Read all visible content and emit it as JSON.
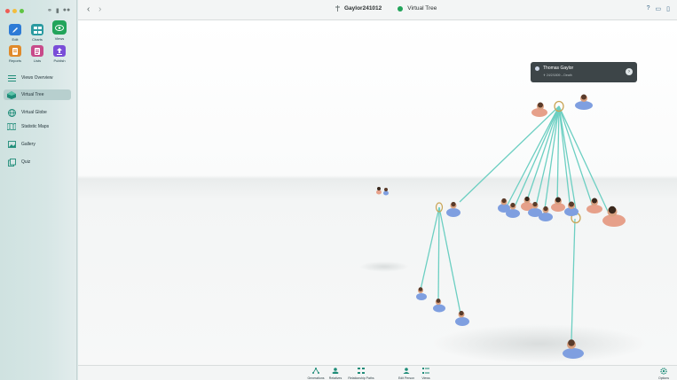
{
  "sidebar": {
    "tools": [
      {
        "label": "Edit",
        "icon": "pencil-icon",
        "color": "#2d7bd6"
      },
      {
        "label": "Charts",
        "icon": "charts-icon",
        "color": "#2a9aa0"
      },
      {
        "label": "Views",
        "icon": "eye-icon",
        "color": "#22a45a"
      },
      {
        "label": "Reports",
        "icon": "reports-icon",
        "color": "#e08a2a"
      },
      {
        "label": "Lists",
        "icon": "lists-icon",
        "color": "#c84a8a"
      },
      {
        "label": "Publish",
        "icon": "publish-icon",
        "color": "#7a4ed8"
      }
    ],
    "nav": [
      {
        "label": "Views Overview",
        "icon": "views-overview-icon"
      },
      {
        "label": "Virtual Tree",
        "icon": "virtual-tree-icon"
      },
      {
        "label": "Virtual Globe",
        "icon": "globe-icon"
      },
      {
        "label": "Statistic Maps",
        "icon": "map-icon"
      },
      {
        "label": "Gallery",
        "icon": "gallery-icon"
      },
      {
        "label": "Quiz",
        "icon": "quiz-icon"
      }
    ],
    "active_nav": "Virtual Tree"
  },
  "titlebar": {
    "file_name": "Gaylor241012",
    "view_name": "Virtual Tree"
  },
  "tooltip": {
    "name": "Thomas Gaylor",
    "detail": "24/2/1809 – Death"
  },
  "bottom_toolbar": [
    {
      "label": "Generations",
      "icon": "generations-icon"
    },
    {
      "label": "Relatives",
      "icon": "relatives-icon"
    },
    {
      "label": "Relationship Paths",
      "icon": "relationship-paths-icon"
    },
    {
      "label": "Edit Person",
      "icon": "edit-person-icon"
    },
    {
      "label": "Views",
      "icon": "views-icon"
    },
    {
      "label": "Options",
      "icon": "gear-icon"
    }
  ],
  "colors": {
    "accent": "#1e8c78",
    "connector": "#6ccfc2",
    "male": "#7f9fe0",
    "female": "#e6a08a"
  }
}
